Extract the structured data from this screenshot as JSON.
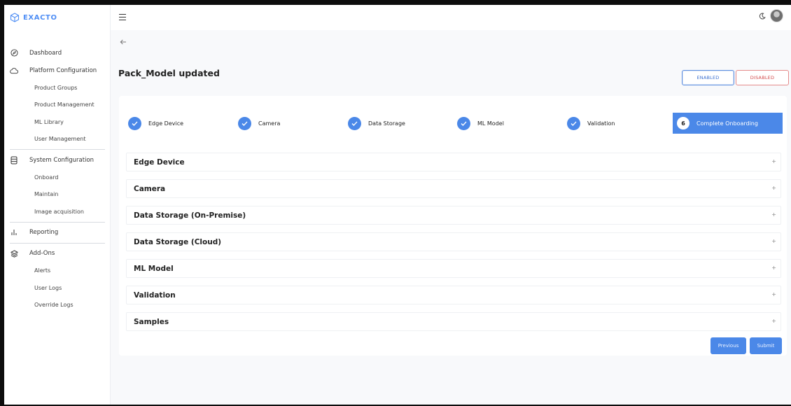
{
  "app": {
    "brand": "EXACTO"
  },
  "sidebar": {
    "items": [
      {
        "label": "Dashboard",
        "icon": "compass-icon"
      },
      {
        "label": "Platform Configuration",
        "icon": "cloud-icon",
        "children": [
          "Product Groups",
          "Product Management",
          "ML Library",
          "User Management"
        ]
      },
      {
        "label": "System Configuration",
        "icon": "database-icon",
        "children": [
          "Onboard",
          "Maintain",
          "Image acquisition"
        ]
      },
      {
        "label": "Reporting",
        "icon": "bar-chart-icon"
      },
      {
        "label": "Add-Ons",
        "icon": "layers-icon",
        "children": [
          "Alerts",
          "User Logs",
          "Override Logs"
        ]
      }
    ]
  },
  "main": {
    "title": "Pack_Model updated",
    "status_buttons": {
      "enabled": "ENABLED",
      "disabled": "DISABLED"
    },
    "steps": [
      {
        "label": "Edge Device",
        "done": true
      },
      {
        "label": "Camera",
        "done": true
      },
      {
        "label": "Data Storage",
        "done": true
      },
      {
        "label": "ML Model",
        "done": true
      },
      {
        "label": "Validation",
        "done": true
      },
      {
        "label": "Complete Onboarding",
        "number": "6",
        "active": true
      }
    ],
    "sections": [
      "Edge Device",
      "Camera",
      "Data Storage (On-Premise)",
      "Data Storage (Cloud)",
      "ML Model",
      "Validation",
      "Samples"
    ],
    "expand_symbol": "+",
    "buttons": {
      "previous": "Previous",
      "submit": "Submit"
    }
  },
  "colors": {
    "accent": "#4b88e8",
    "enabled": "#3a6fd0",
    "disabled": "#d24a4a"
  }
}
